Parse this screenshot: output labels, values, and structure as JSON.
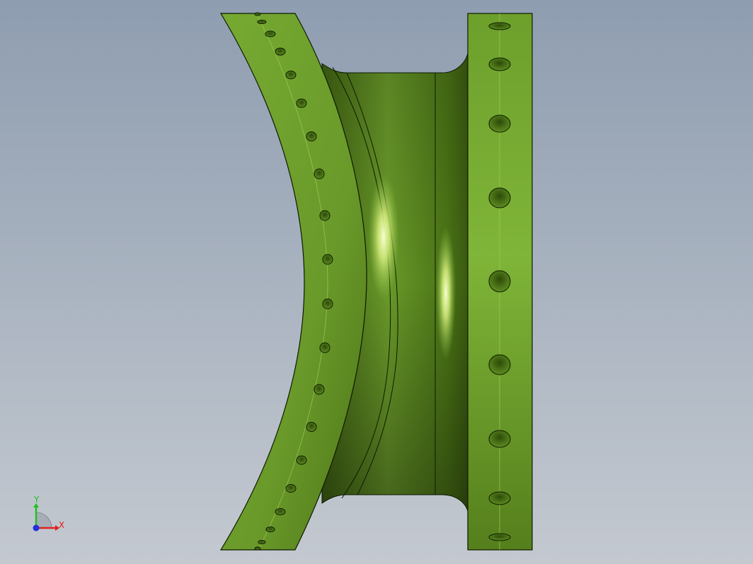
{
  "viewport": {
    "background_top": "#8e9db0",
    "background_bottom": "#c4c9d0"
  },
  "part": {
    "base_color": "#6a9a2a",
    "light_color": "#88c040",
    "dark_color": "#2f4a0c",
    "highlight_color": "#f2ffb8",
    "edge_color": "#0d1a00"
  },
  "triad": {
    "x_label": "X",
    "y_label": "Y",
    "x_color": "#e02020",
    "y_color": "#20c020",
    "z_color": "#2030e0"
  }
}
